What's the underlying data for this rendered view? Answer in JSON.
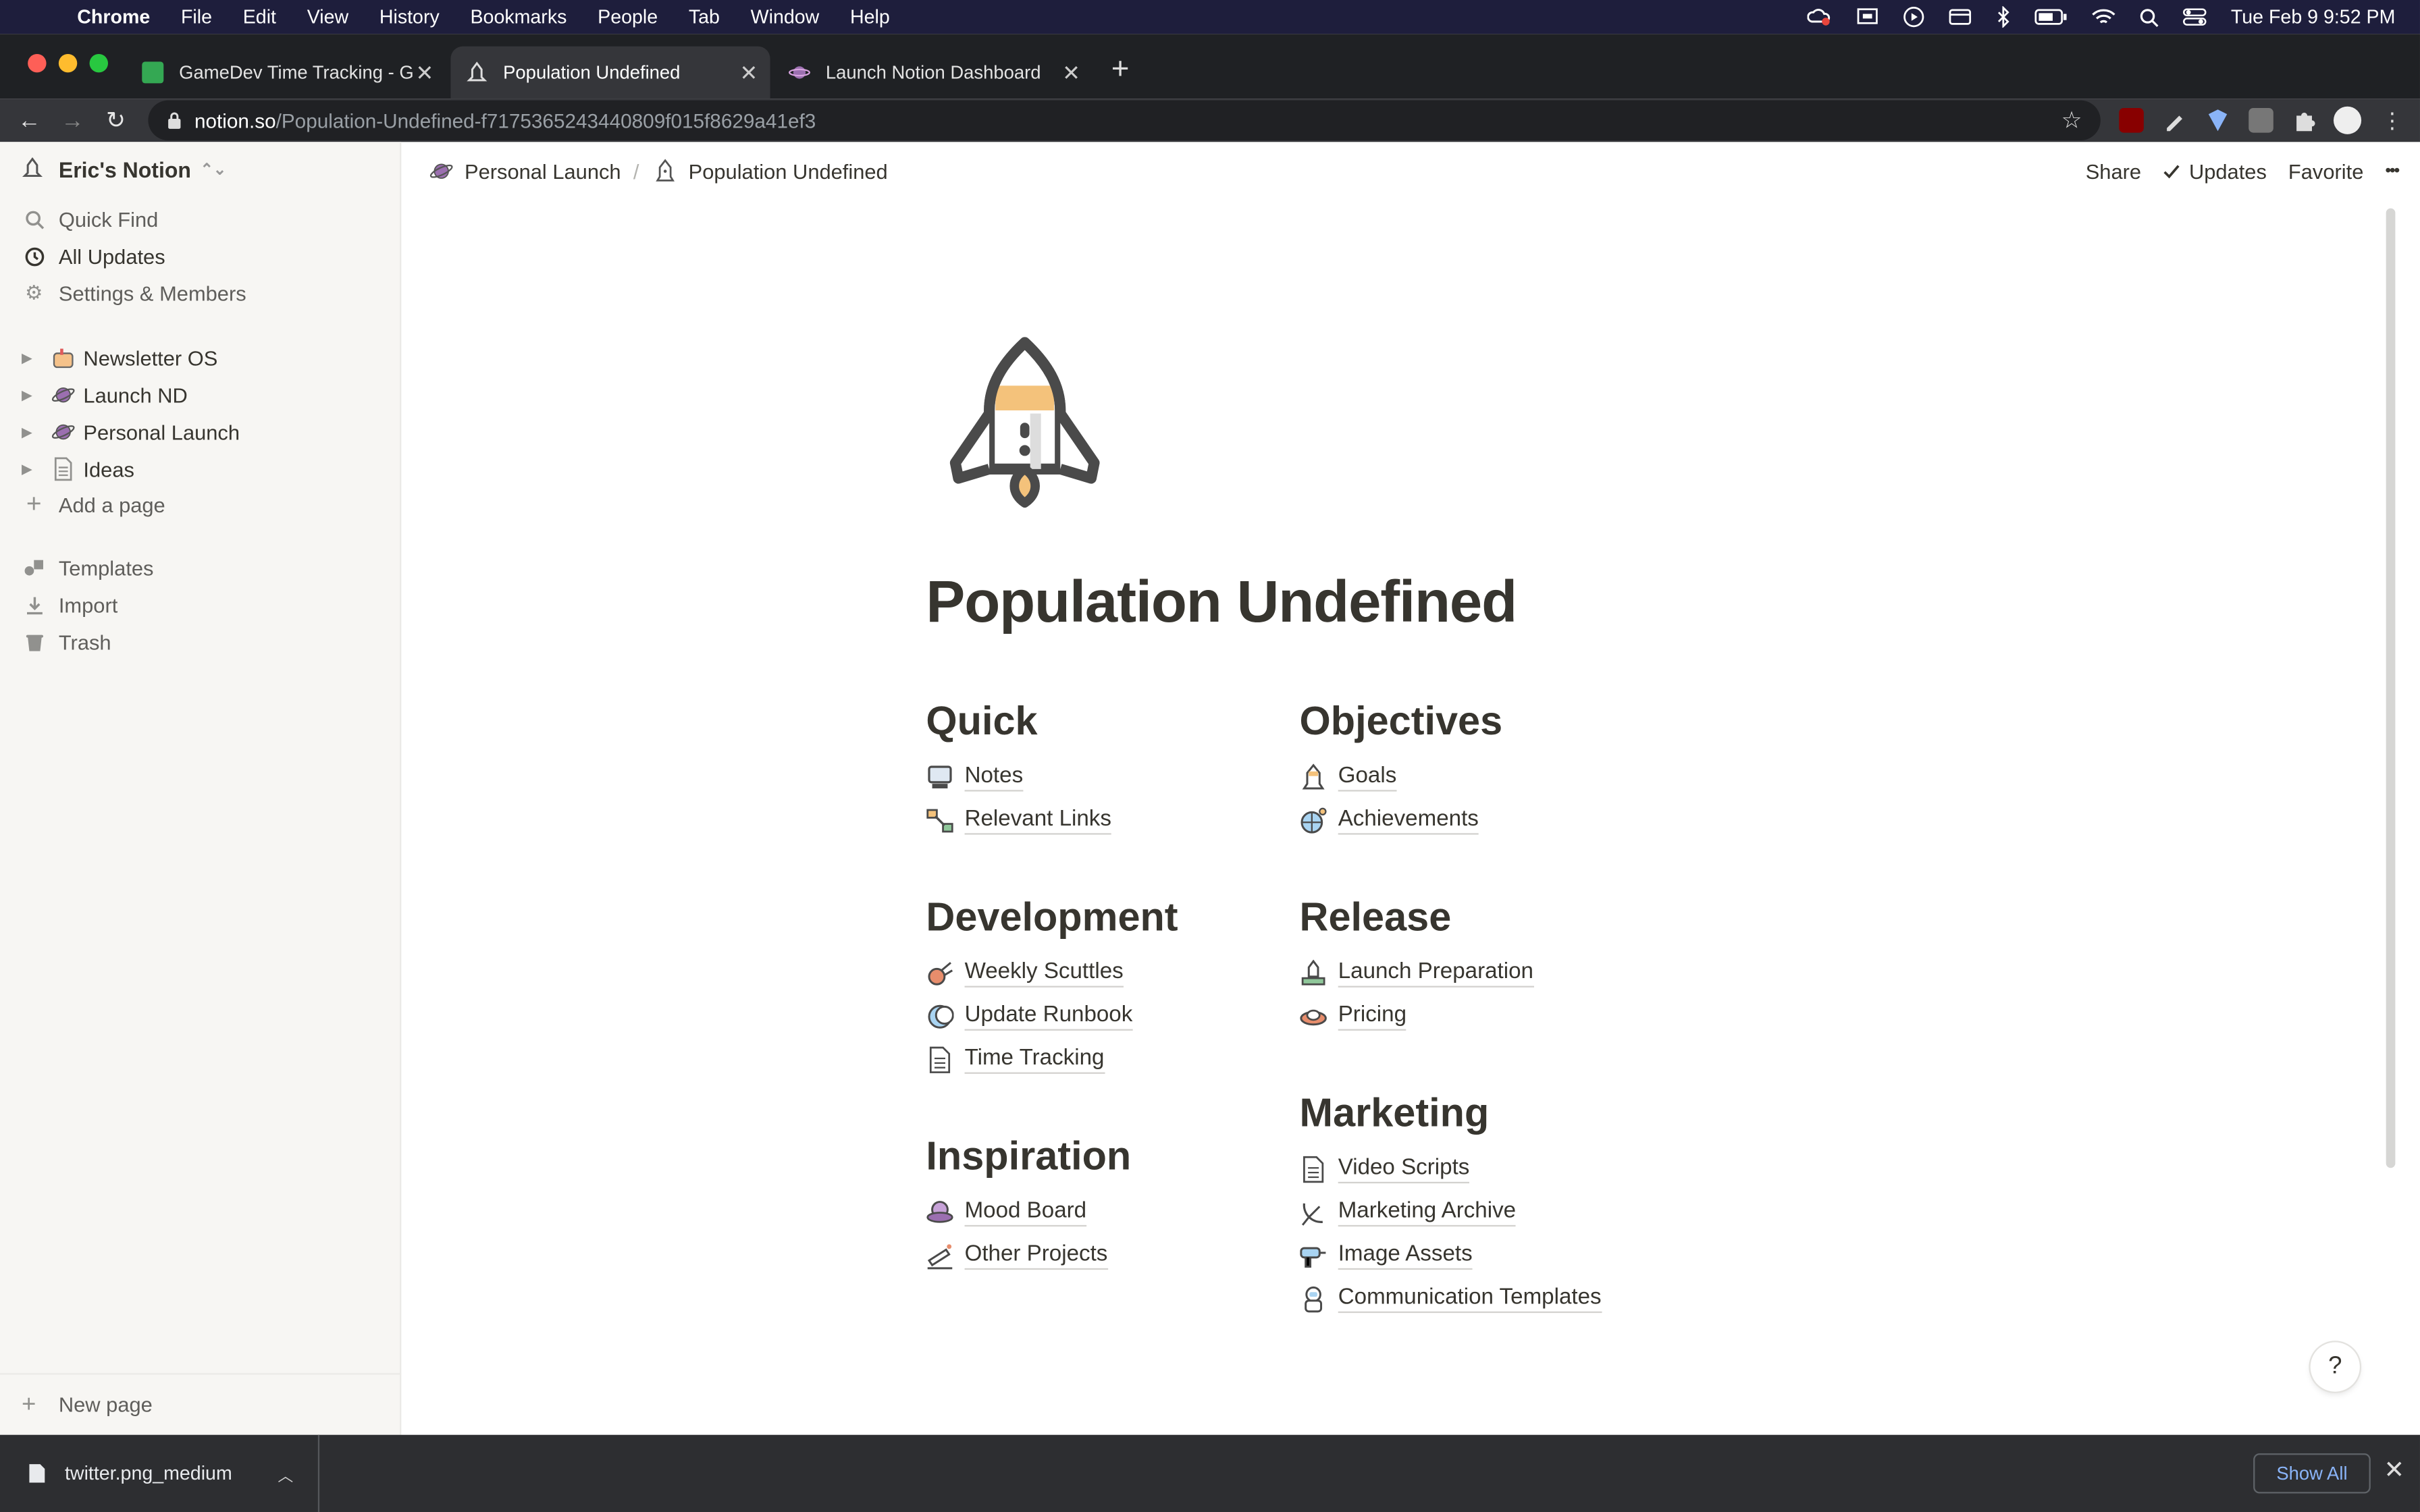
{
  "menubar": {
    "app": "Chrome",
    "items": [
      "File",
      "Edit",
      "View",
      "History",
      "Bookmarks",
      "People",
      "Tab",
      "Window",
      "Help"
    ],
    "clock": "Tue Feb 9  9:52 PM"
  },
  "tabs": [
    {
      "title": "GameDev Time Tracking - Goo",
      "icon": "sheets-icon",
      "color": "#34a853"
    },
    {
      "title": "Population Undefined",
      "icon": "rocket-icon"
    },
    {
      "title": "Launch Notion Dashboard",
      "icon": "planet-icon"
    }
  ],
  "address": {
    "host": "notion.so",
    "path": "/Population-Undefined-f7175365243440809f015f8629a41ef3"
  },
  "sidebar": {
    "workspace": "Eric's Notion",
    "nav": [
      {
        "label": "Quick Find",
        "icon": "search-icon"
      },
      {
        "label": "All Updates",
        "icon": "clock-icon"
      },
      {
        "label": "Settings & Members",
        "icon": "gear-icon"
      }
    ],
    "pages": [
      {
        "label": "Newsletter OS",
        "icon": "mailbox-icon"
      },
      {
        "label": "Launch ND",
        "icon": "planet-icon"
      },
      {
        "label": "Personal Launch",
        "icon": "planet-icon"
      },
      {
        "label": "Ideas",
        "icon": "page-icon"
      }
    ],
    "add_page": "Add a page",
    "tools": [
      {
        "label": "Templates",
        "icon": "templates-icon"
      },
      {
        "label": "Import",
        "icon": "import-icon"
      },
      {
        "label": "Trash",
        "icon": "trash-icon"
      }
    ],
    "new_page": "New page"
  },
  "topbar": {
    "breadcrumb": [
      "Personal Launch",
      "Population Undefined"
    ],
    "share": "Share",
    "updates": "Updates",
    "favorite": "Favorite",
    "more": "•••"
  },
  "page": {
    "title": "Population Undefined",
    "sections": {
      "quick": {
        "heading": "Quick",
        "links": [
          "Notes",
          "Relevant Links"
        ]
      },
      "objectives": {
        "heading": "Objectives",
        "links": [
          "Goals",
          "Achievements"
        ]
      },
      "development": {
        "heading": "Development",
        "links": [
          "Weekly Scuttles",
          "Update Runbook",
          "Time Tracking"
        ]
      },
      "release": {
        "heading": "Release",
        "links": [
          "Launch Preparation",
          "Pricing"
        ]
      },
      "inspiration": {
        "heading": "Inspiration",
        "links": [
          "Mood Board",
          "Other Projects"
        ]
      },
      "marketing": {
        "heading": "Marketing",
        "links": [
          "Video Scripts",
          "Marketing Archive",
          "Image Assets",
          "Communication Templates"
        ]
      }
    },
    "help": "?"
  },
  "download": {
    "file": "twitter.png_medium",
    "show_all": "Show All"
  }
}
